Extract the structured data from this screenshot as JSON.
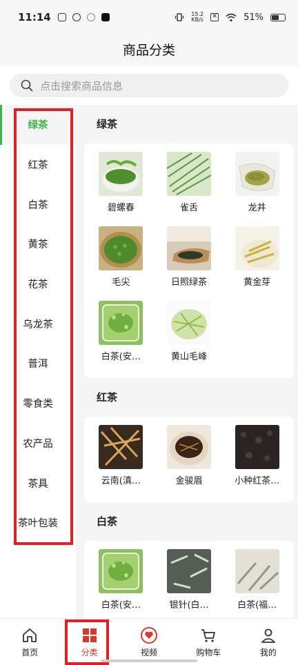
{
  "status": {
    "time": "11:14",
    "speed_value": "15.2",
    "speed_unit": "KB/s",
    "battery": "51%"
  },
  "header": {
    "title": "商品分类"
  },
  "search": {
    "placeholder": "点击搜索商品信息"
  },
  "sidebar": {
    "items": [
      {
        "label": "绿茶",
        "active": true
      },
      {
        "label": "红茶"
      },
      {
        "label": "白茶"
      },
      {
        "label": "黄茶"
      },
      {
        "label": "花茶"
      },
      {
        "label": "乌龙茶"
      },
      {
        "label": "普洱"
      },
      {
        "label": "零食类"
      },
      {
        "label": "农产品"
      },
      {
        "label": "茶具"
      },
      {
        "label": "茶叶包装"
      }
    ]
  },
  "sections": [
    {
      "title": "绿茶",
      "products": [
        {
          "name": "碧螺春",
          "thumb": "green-tea-bowl"
        },
        {
          "name": "雀舌",
          "thumb": "green-needle-leaves"
        },
        {
          "name": "龙井",
          "thumb": "flat-tea-dish"
        },
        {
          "name": "毛尖",
          "thumb": "green-basket"
        },
        {
          "name": "日照绿茶",
          "thumb": "dark-tea-spoon"
        },
        {
          "name": "黄金芽",
          "thumb": "golden-buds"
        },
        {
          "name": "白茶(安…",
          "thumb": "brewed-tea-glass"
        },
        {
          "name": "黄山毛峰",
          "thumb": "light-green-pile"
        }
      ]
    },
    {
      "title": "红茶",
      "products": [
        {
          "name": "云南(滇…",
          "thumb": "golden-leaves"
        },
        {
          "name": "金骏眉",
          "thumb": "black-tea-bowl"
        },
        {
          "name": "小种红茶…",
          "thumb": "dark-loose-tea"
        }
      ]
    },
    {
      "title": "白茶",
      "products": [
        {
          "name": "白茶(安…",
          "thumb": "brewed-tea-glass"
        },
        {
          "name": "银针(白…",
          "thumb": "silver-needle"
        },
        {
          "name": "白茶(福…",
          "thumb": "white-peony-leaves"
        }
      ]
    }
  ],
  "bottom_nav": [
    {
      "label": "首页",
      "icon": "home-icon"
    },
    {
      "label": "分类",
      "icon": "grid-icon",
      "active": true
    },
    {
      "label": "视频",
      "icon": "heart-video-icon"
    },
    {
      "label": "购物车",
      "icon": "cart-icon"
    },
    {
      "label": "我的",
      "icon": "user-icon"
    }
  ],
  "colors": {
    "accent_green": "#3db54a",
    "nav_active": "#d9372b",
    "highlight_red": "#e01f27"
  }
}
